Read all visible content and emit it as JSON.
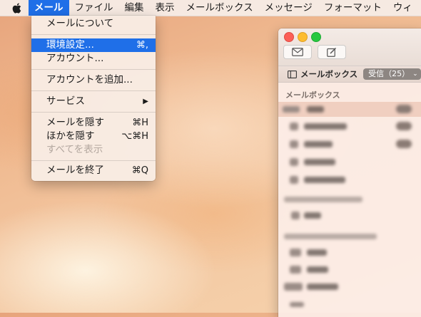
{
  "menubar": {
    "items": [
      {
        "label": "メール"
      },
      {
        "label": "ファイル"
      },
      {
        "label": "編集"
      },
      {
        "label": "表示"
      },
      {
        "label": "メールボックス"
      },
      {
        "label": "メッセージ"
      },
      {
        "label": "フォーマット"
      },
      {
        "label": "ウィ"
      }
    ]
  },
  "mail_menu": {
    "about": "メールについて",
    "preferences": "環境設定...",
    "preferences_shortcut": "⌘,",
    "accounts": "アカウント...",
    "add_account": "アカウントを追加...",
    "services": "サービス",
    "services_arrow": "▶",
    "hide_mail": "メールを隠す",
    "hide_mail_shortcut": "⌘H",
    "hide_others": "ほかを隠す",
    "hide_others_shortcut": "⌥⌘H",
    "show_all": "すべてを表示",
    "quit": "メールを終了",
    "quit_shortcut": "⌘Q"
  },
  "mail_window": {
    "favorites_label": "メールボックス",
    "inbox_pill": "受信（25）",
    "mailboxes_header": "メールボックス"
  },
  "colors": {
    "highlight": "#1f6fe8",
    "close": "#fc5f57",
    "minimize": "#fdbc2e",
    "zoom": "#28c840"
  }
}
